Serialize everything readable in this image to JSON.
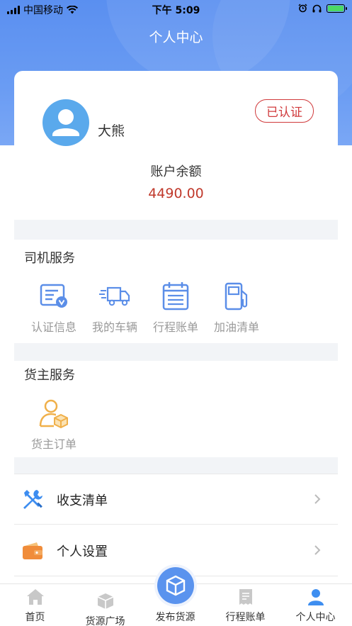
{
  "status_bar": {
    "carrier": "中国移动",
    "time": "下午 5:09"
  },
  "header": {
    "title": "个人中心"
  },
  "profile": {
    "name": "大熊",
    "verified_label": "已认证",
    "balance_label": "账户余额",
    "balance_value": "4490.00"
  },
  "driver_services": {
    "title": "司机服务",
    "items": [
      {
        "label": "认证信息",
        "icon": "id-card-icon"
      },
      {
        "label": "我的车辆",
        "icon": "truck-icon"
      },
      {
        "label": "行程账单",
        "icon": "calendar-icon"
      },
      {
        "label": "加油清单",
        "icon": "fuel-pump-icon"
      }
    ]
  },
  "shipper_services": {
    "title": "货主服务",
    "items": [
      {
        "label": "货主订单",
        "icon": "shipper-package-icon"
      }
    ]
  },
  "menu": [
    {
      "label": "收支清单",
      "icon": "tools-icon"
    },
    {
      "label": "个人设置",
      "icon": "wallet-icon"
    }
  ],
  "tabbar": {
    "items": [
      {
        "label": "首页",
        "icon": "home-icon"
      },
      {
        "label": "货源广场",
        "icon": "box-icon"
      },
      {
        "label": "发布货源",
        "icon": "publish-box-icon"
      },
      {
        "label": "行程账单",
        "icon": "receipt-icon"
      },
      {
        "label": "个人中心",
        "icon": "person-icon"
      }
    ],
    "active_color": "#3e8ef0",
    "inactive_icon_color": "#c8c8c8"
  },
  "colors": {
    "header_blue": "#5a8ff0",
    "icon_blue": "#5b8ee8",
    "shipper_orange": "#f0b04a",
    "badge_red": "#d0393b",
    "balance_red": "#c0392b"
  }
}
